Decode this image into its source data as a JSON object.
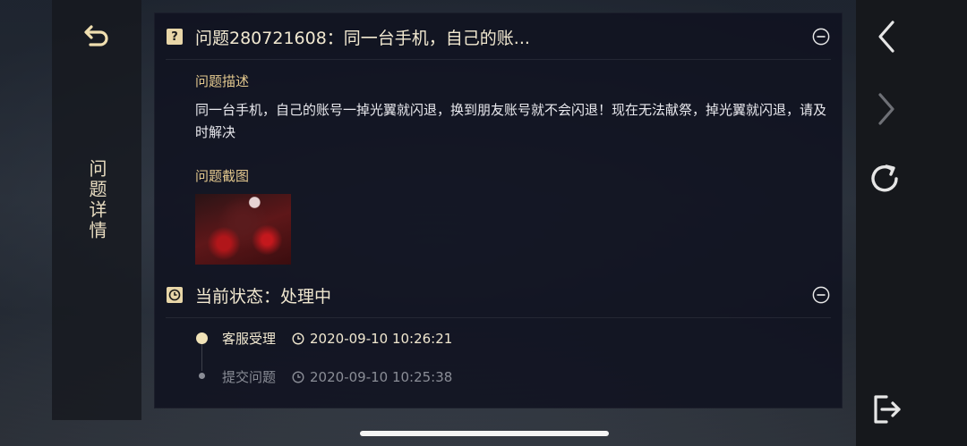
{
  "left_panel": {
    "title": "问题详情",
    "back_icon": "return-arrow-icon"
  },
  "question": {
    "header": "问题280721608：同一台手机，自己的账...",
    "badge_glyph": "?",
    "description_label": "问题描述",
    "description": "同一台手机，自己的账号一掉光翼就闪退，换到朋友账号就不会闪退！现在无法献祭，掉光翼就闪退，请及时解决",
    "screenshot_label": "问题截图"
  },
  "status": {
    "header": "当前状态：处理中",
    "timeline": [
      {
        "label": "客服受理",
        "time": "2020-09-10 10:26:21",
        "active": true
      },
      {
        "label": "提交问题",
        "time": "2020-09-10 10:25:38",
        "active": false
      }
    ]
  },
  "colors": {
    "accent_gold": "#e3c88e",
    "active_text": "#f1e8d0",
    "inactive_text": "#8a8d96"
  },
  "right_nav": {
    "icons": [
      "chevron-left-icon",
      "chevron-right-icon",
      "refresh-icon",
      "exit-icon"
    ]
  }
}
